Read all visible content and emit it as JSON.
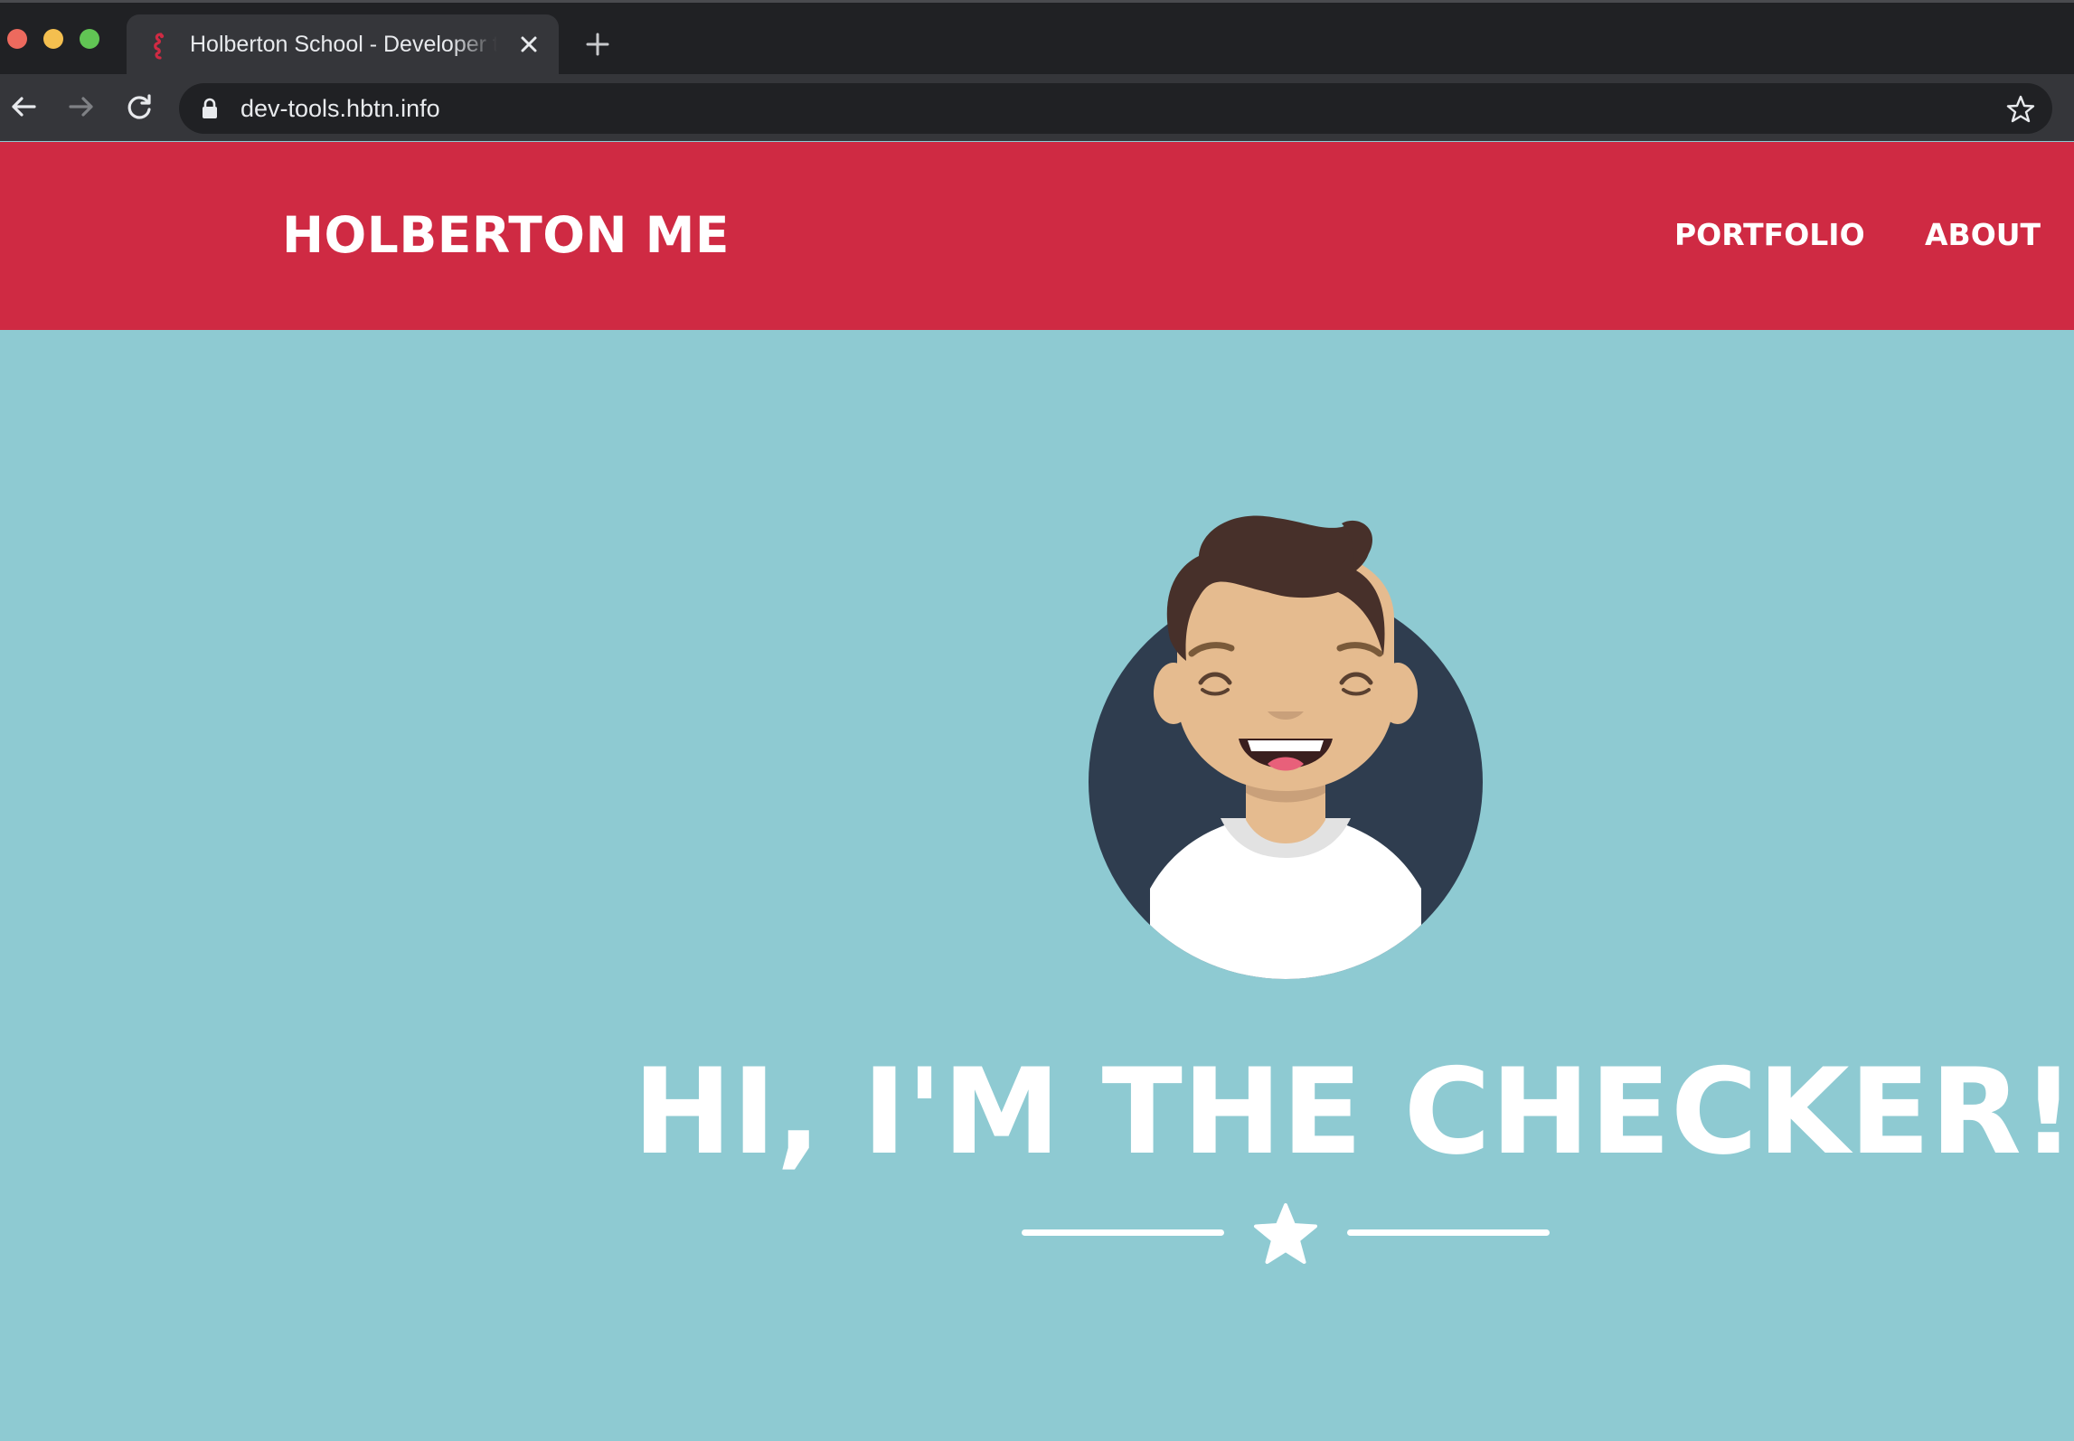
{
  "browser": {
    "tab": {
      "title": "Holberton School - Developer tools"
    },
    "address_bar": {
      "url": "dev-tools.hbtn.info"
    },
    "icons": {
      "tab_favicon": "seahorse-icon",
      "tab_close": "close-icon",
      "new_tab": "plus-icon",
      "back": "arrow-left-icon",
      "forward": "arrow-right-icon",
      "reload": "reload-icon",
      "lock": "lock-icon",
      "bookmark": "star-outline-icon"
    },
    "colors": {
      "chrome_dark": "#202124",
      "chrome_mid": "#35363a",
      "chrome_text": "#e8eaed"
    }
  },
  "site": {
    "header": {
      "brand": "HOLBERTON ME",
      "nav": [
        {
          "label": "PORTFOLIO"
        },
        {
          "label": "ABOUT"
        }
      ]
    },
    "hero": {
      "title": "HI, I'M THE CHECKER!",
      "avatar": "smiling-person-avatar",
      "divider_icon": "star-icon"
    },
    "colors": {
      "header_bg": "#cf2a43",
      "hero_bg": "#8ecad2",
      "text": "#ffffff",
      "avatar_circle": "#2f3d4f",
      "hair": "#47302a",
      "skin": "#e5bb8f"
    }
  }
}
